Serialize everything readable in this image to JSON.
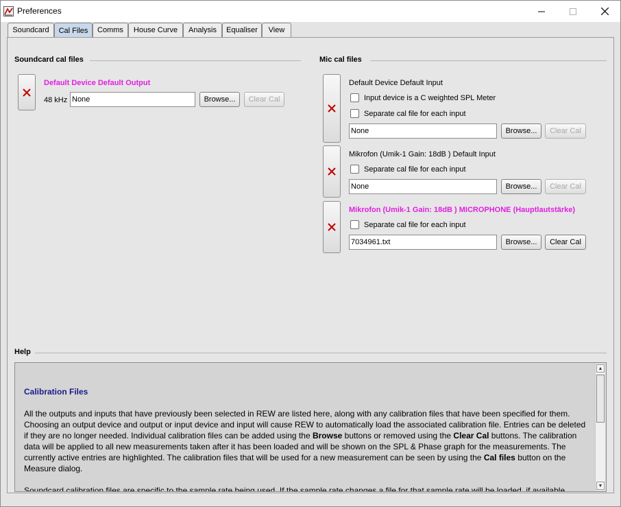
{
  "window": {
    "title": "Preferences",
    "min_glyph": "—",
    "max_glyph": "☐",
    "close_glyph": "✕"
  },
  "tabs": [
    {
      "label": "Soundcard"
    },
    {
      "label": "Cal Files",
      "selected": true
    },
    {
      "label": "Comms"
    },
    {
      "label": "House Curve"
    },
    {
      "label": "Analysis"
    },
    {
      "label": "Equaliser"
    },
    {
      "label": "View"
    }
  ],
  "soundcard": {
    "section_title": "Soundcard cal files",
    "entries": [
      {
        "device": "Default Device Default Output",
        "rate": "48 kHz",
        "file": "None",
        "browse": "Browse...",
        "clear": "Clear Cal",
        "highlight_color": "#e020e0"
      }
    ]
  },
  "mic": {
    "section_title": "Mic cal files",
    "entries": [
      {
        "device": "Default Device Default Input",
        "c_weighted": "Input device is a C weighted SPL Meter",
        "separate": "Separate cal file for each input",
        "file": "None",
        "browse": "Browse...",
        "clear": "Clear Cal"
      },
      {
        "device": "Mikrofon (Umik-1  Gain: 18dB  ) Default Input",
        "separate": "Separate cal file for each input",
        "file": "None",
        "browse": "Browse...",
        "clear": "Clear Cal"
      },
      {
        "device": "Mikrofon (Umik-1  Gain: 18dB  ) MICROPHONE (Hauptlautstärke)",
        "separate": "Separate cal file for each input",
        "file": "7034961.txt",
        "browse": "Browse...",
        "clear": "Clear Cal",
        "highlighted": true
      }
    ]
  },
  "help": {
    "section_title": "Help",
    "heading": "Calibration Files",
    "para1": {
      "t1": "All the outputs and inputs that have previously been selected in REW are listed here, along with any calibration files that have been specified for them. Choosing an output device and output or input device and input will cause REW to automatically load the associated calibration file. Entries can be deleted if they are no longer needed. Individual calibration files can be added using the ",
      "b1": "Browse",
      "t2": " buttons or removed using the ",
      "b2": "Clear Cal",
      "t3": " buttons. The calibration data will be applied to all new measurements taken after it has been loaded and will be shown on the SPL & Phase graph for the measurements. The currently active entries are highlighted. The calibration files that will be used for a new measurement can be seen by using the ",
      "b3": "Cal files",
      "t4": " button on the Measure dialog."
    },
    "para2": "Soundcard calibration files are specific to the sample rate being used. If the sample rate changes a file for that sample rate will be loaded, if available."
  },
  "colors": {
    "highlight": "#e020e0",
    "delete_x": "#c00000",
    "help_heading": "#1a1a8c"
  }
}
